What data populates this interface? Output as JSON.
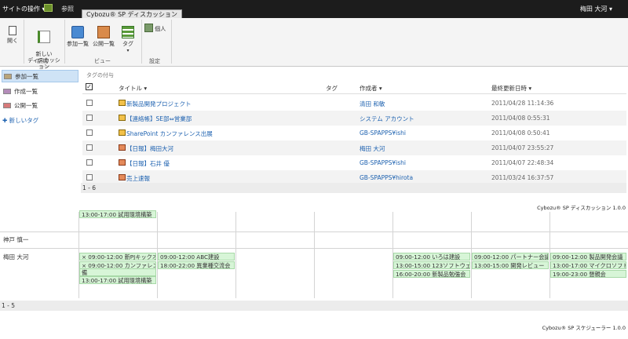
{
  "topbar": {
    "site_actions": "サイトの操作 ▾",
    "browse": "参照",
    "active_tab": "Cybozu® SP ディスカッション",
    "user": "梅田 大河 ▾"
  },
  "ribbon": {
    "buttons": {
      "open": "開く",
      "new_discussion": "新しい\nディスカッション",
      "joined_list": "参加一覧",
      "public_list": "公開一覧",
      "tag": "タグ",
      "personal": "個人"
    },
    "groups": {
      "new": "新規",
      "view": "ビュー",
      "settings": "設定"
    }
  },
  "leftnav": {
    "items": [
      {
        "label": "参加一覧",
        "color": "#b9a47a"
      },
      {
        "label": "作成一覧",
        "color": "#b48cb9"
      },
      {
        "label": "公開一覧",
        "color": "#d77a7a"
      }
    ],
    "new_tag": "✚ 新しいタグ"
  },
  "grid": {
    "tag_filter": "タグの付与",
    "headers": {
      "title": "タイトル ▾",
      "tag": "タグ",
      "author": "作成者 ▾",
      "updated": "最終更新日時 ▾"
    },
    "rows": [
      {
        "title": "新製品開発プロジェクト",
        "author": "清田 和敏",
        "date": "2011/04/28 11:14:36"
      },
      {
        "title": "【連絡帳】SE部⇔営業部",
        "author": "システム アカウント",
        "date": "2011/04/08 0:55:31"
      },
      {
        "title": "SharePoint カンファレンス出展",
        "author": "GB-SPAPPS¥ishi",
        "date": "2011/04/08 0:50:41"
      },
      {
        "title": "【日報】梅田大河",
        "author": "梅田 大河",
        "date": "2011/04/07 23:55:27"
      },
      {
        "title": "【日報】石井 優",
        "author": "GB-SPAPPS¥ishi",
        "date": "2011/04/07 22:48:34"
      },
      {
        "title": "売上速報",
        "author": "GB-SPAPPS¥hirota",
        "date": "2011/03/24 16:37:57"
      }
    ],
    "paging": "1 - 6",
    "product": "Cybozu® SP ディスカッション 1.0.0"
  },
  "schedule": {
    "top_events": [
      {
        "text": "13:00-17:00 試用環境構築"
      }
    ],
    "people": [
      {
        "name": "神戸 慎一"
      },
      {
        "name": "梅田 大河"
      }
    ],
    "col0": [
      {
        "text": "× 09:00-12:00 新PJキックオフ"
      },
      {
        "text": "× 09:00-12:00 カンファレンス準"
      },
      {
        "text": "備"
      },
      {
        "text": "13:00-17:00 試用環境構築"
      }
    ],
    "col1": [
      {
        "text": "09:00-12:00 ABC建設"
      },
      {
        "text": "18:00-22:00 異業種交流会"
      }
    ],
    "col4": [
      {
        "text": "09:00-12:00 いろは建設"
      },
      {
        "text": "13:00-15:00 123ソフトウェア"
      },
      {
        "text": "16:00-20:00 新製品勉強会"
      }
    ],
    "col5": [
      {
        "text": "09:00-12:00 パートナー会議"
      },
      {
        "text": "13:00-15:00 開発レビュー"
      }
    ],
    "col6": [
      {
        "text": "09:00-12:00 製品開発会議"
      },
      {
        "text": "13:00-17:00 マイクロソフト"
      },
      {
        "text": "19:00-23:00 懇親会"
      }
    ],
    "paging": "1 - 5",
    "product": "Cybozu® SP スケジューラー 1.0.0"
  }
}
